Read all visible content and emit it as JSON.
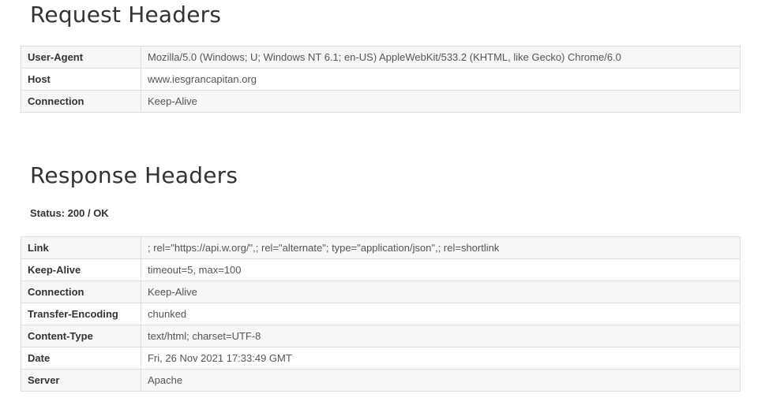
{
  "request": {
    "title": "Request Headers",
    "rows": [
      {
        "key": "User-Agent",
        "value": "Mozilla/5.0 (Windows; U; Windows NT 6.1; en-US) AppleWebKit/533.2 (KHTML, like Gecko) Chrome/6.0"
      },
      {
        "key": "Host",
        "value": "www.iesgrancapitan.org"
      },
      {
        "key": "Connection",
        "value": "Keep-Alive"
      }
    ]
  },
  "response": {
    "title": "Response Headers",
    "status": "Status: 200 / OK",
    "rows": [
      {
        "key": "Link",
        "value": "; rel=\"https://api.w.org/\",; rel=\"alternate\"; type=\"application/json\",; rel=shortlink"
      },
      {
        "key": "Keep-Alive",
        "value": "timeout=5, max=100"
      },
      {
        "key": "Connection",
        "value": "Keep-Alive"
      },
      {
        "key": "Transfer-Encoding",
        "value": "chunked"
      },
      {
        "key": "Content-Type",
        "value": "text/html; charset=UTF-8"
      },
      {
        "key": "Date",
        "value": "Fri, 26 Nov 2021 17:33:49 GMT"
      },
      {
        "key": "Server",
        "value": "Apache"
      }
    ]
  }
}
